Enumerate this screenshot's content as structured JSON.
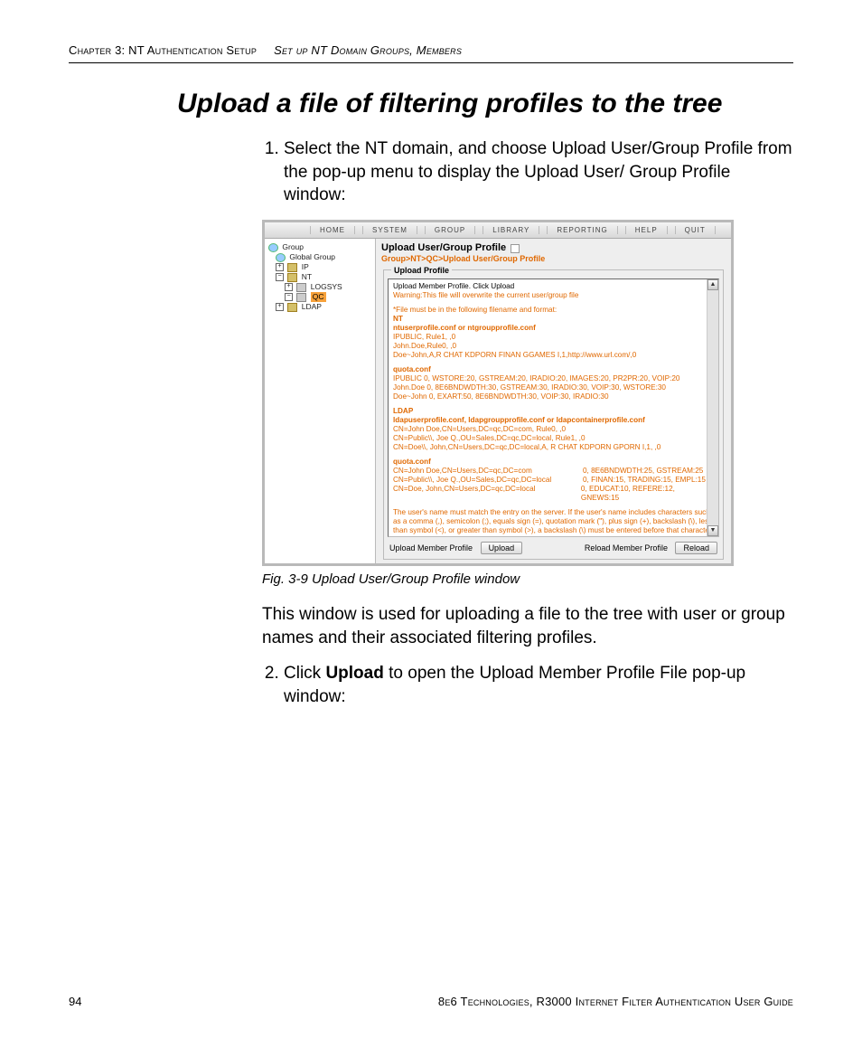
{
  "header": {
    "chapter": "Chapter 3: NT Authentication Setup",
    "section": "Set up NT Domain Groups, Members"
  },
  "heading": "Upload a file of filtering profiles to the tree",
  "step1": "Select the NT domain, and choose Upload User/Group Profile from the pop-up menu to display the Upload User/ Group Profile window:",
  "figCaption": "Fig. 3-9  Upload User/Group Profile window",
  "afterFig": "This window is used for uploading a file to the tree with user or group names and their associated filtering profiles.",
  "step2_pre": "Click ",
  "step2_bold": "Upload",
  "step2_post": " to open the Upload Member Profile File pop-up window:",
  "screenshot": {
    "menubar": [
      "HOME",
      "SYSTEM",
      "GROUP",
      "LIBRARY",
      "REPORTING",
      "HELP",
      "QUIT"
    ],
    "tree": {
      "root": "Group",
      "items": [
        "Global Group",
        "IP",
        "NT",
        "LOGSYS",
        "QC",
        "LDAP"
      ]
    },
    "main": {
      "title": "Upload User/Group Profile",
      "breadcrumb": "Group>NT>QC>Upload User/Group Profile",
      "panelTitle": "Upload Profile",
      "lines": {
        "l1": "Upload Member Profile.  Click Upload",
        "l2": "Warning:This file will overwrite the current user/group file",
        "l3": "*File must be in the following filename and format:",
        "nt": "NT",
        "nt1": "ntuserprofile.conf or ntgroupprofile.conf",
        "nt2": "IPUBLIC, Rule1, ,0",
        "nt3": "John.Doe,Rule0, ,0",
        "nt4": "Doe~John,A,R CHAT KDPORN FINAN GGAMES I,1,http://www.url.com/,0",
        "q": "quota.conf",
        "q1": "IPUBLIC    0, WSTORE:20, GSTREAM:20, IRADIO:20, IMAGES:20, PR2PR:20, VOIP:20",
        "q2": "John.Doe   0, 8E6BNDWDTH:30, GSTREAM:30, IRADIO:30, VOIP:30, WSTORE:30",
        "q3": "Doe~John   0, EXART:50, 8E6BNDWDTH:30, VOIP:30, IRADIO:30",
        "ld": "LDAP",
        "ld1": "ldapuserprofile.conf, ldapgroupprofile.conf or ldapcontainerprofile.conf",
        "ld2": "CN=John Doe,CN=Users,DC=qc,DC=com, Rule0, ,0",
        "ld3": "CN=Public\\\\, Joe Q.,OU=Sales,DC=qc,DC=local, Rule1, ,0",
        "ld4": "CN=Doe\\\\, John,CN=Users,DC=qc,DC=local,A, R CHAT KDPORN GPORN I,1, ,0",
        "q2h": "quota.conf",
        "q2a": "CN=John Doe,CN=Users,DC=qc,DC=com",
        "q2av": "0, 8E6BNDWDTH:25, GSTREAM:25",
        "q2b": "CN=Public\\\\, Joe Q.,OU=Sales,DC=qc,DC=local",
        "q2bv": "0, FINAN:15, TRADING:15, EMPL:15",
        "q2c": "CN=Doe, John,CN=Users,DC=qc,DC=local",
        "q2cv": "0, EDUCAT:10, REFERE:12, GNEWS:15",
        "note": "The user's name must match the entry on the server. If the user's name includes characters such as a comma (,), semicolon (;), equals sign (=), quotation mark (\"), plus sign (+), backslash (\\), less than symbol (<), or greater than symbol (>), a backslash (\\) must be entered before that character"
      },
      "btn": {
        "leftLabel": "Upload Member Profile",
        "upload": "Upload",
        "rightLabel": "Reload Member Profile",
        "reload": "Reload"
      }
    }
  },
  "footer": {
    "pageNumber": "94",
    "book": "8e6 Technologies, R3000 Internet Filter Authentication User Guide"
  }
}
